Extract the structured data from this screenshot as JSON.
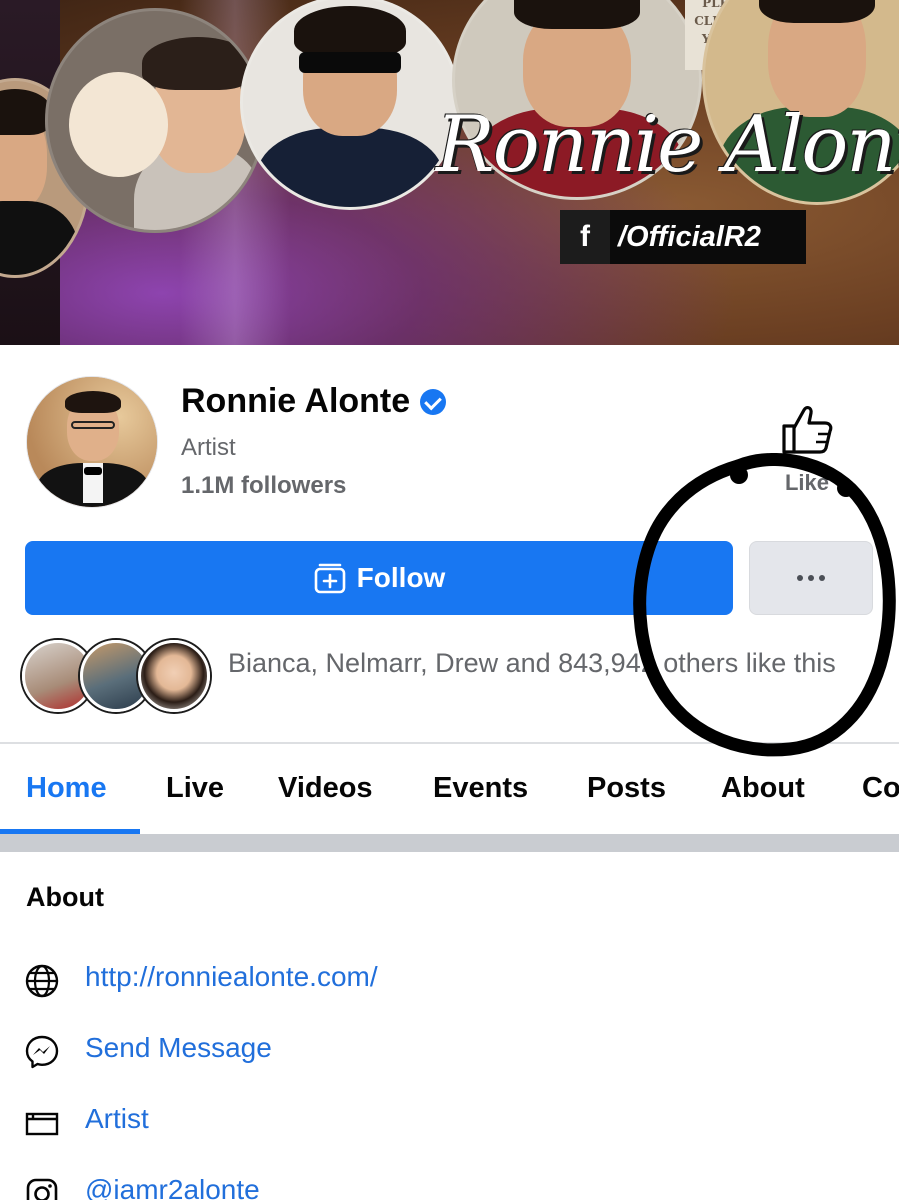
{
  "cover": {
    "title_script": "Ronnie Alonte",
    "fb_letter": "f",
    "fb_handle": "/OfficialR2",
    "sign_lines": [
      "PLEASE",
      "CLEAN AS",
      "YOU GO"
    ]
  },
  "profile": {
    "name": "Ronnie Alonte",
    "category": "Artist",
    "followers": "1.1M followers",
    "like_label": "Like"
  },
  "actions": {
    "follow_label": "Follow"
  },
  "friends": {
    "text": "Bianca, Nelmarr, Drew and 843,942 others like this"
  },
  "tabs": [
    {
      "label": "Home",
      "active": true
    },
    {
      "label": "Live"
    },
    {
      "label": "Videos"
    },
    {
      "label": "Events"
    },
    {
      "label": "Posts"
    },
    {
      "label": "About"
    },
    {
      "label": "Co"
    }
  ],
  "about": {
    "title": "About",
    "items": [
      {
        "icon": "globe-icon",
        "text": "http://ronniealonte.com/"
      },
      {
        "icon": "messenger-icon",
        "text": "Send Message"
      },
      {
        "icon": "category-icon",
        "text": "Artist"
      },
      {
        "icon": "instagram-icon",
        "text": "@iamr2alonte"
      }
    ]
  },
  "colors": {
    "accent": "#1877f2",
    "link": "#216fdb",
    "secondary_text": "#65676b",
    "annotation": "#000000"
  }
}
